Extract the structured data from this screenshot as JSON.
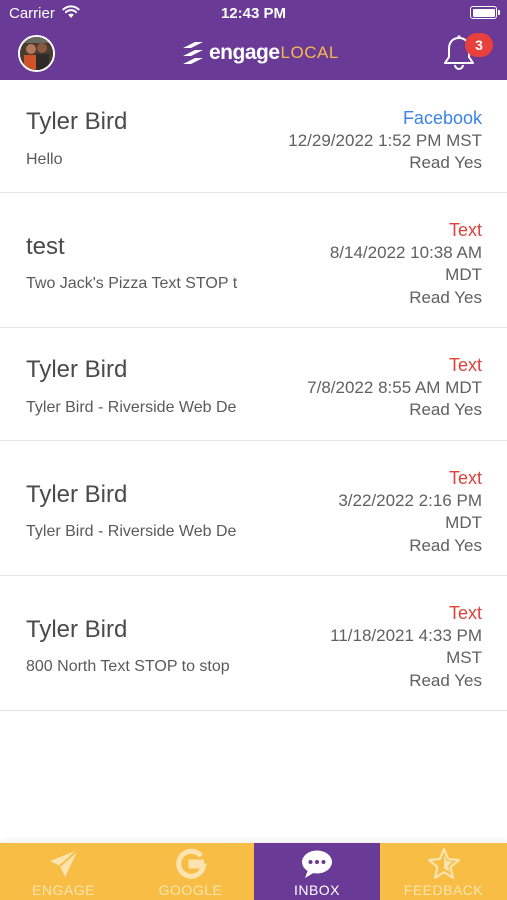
{
  "status_bar": {
    "carrier": "Carrier",
    "time": "12:43 PM",
    "wifi_icon": "wifi-icon",
    "battery_icon": "battery-icon"
  },
  "header": {
    "avatar": "profile-avatar",
    "logo_word_bold": "engage",
    "logo_word_light": "LOCAL",
    "notification_icon": "bell-icon",
    "notification_count": "3"
  },
  "messages": [
    {
      "name": "Tyler Bird",
      "preview": "Hello",
      "source": "Facebook",
      "datetime": "12/29/2022 1:52 PM MST",
      "read": "Read Yes"
    },
    {
      "name": "test",
      "preview": "Two Jack's Pizza  Text STOP t",
      "source": "Text",
      "datetime": "8/14/2022 10:38 AM MDT",
      "read": "Read Yes"
    },
    {
      "name": "Tyler Bird",
      "preview": "Tyler Bird - Riverside Web De",
      "source": "Text",
      "datetime": "7/8/2022 8:55 AM MDT",
      "read": "Read Yes"
    },
    {
      "name": "Tyler Bird",
      "preview": "Tyler Bird - Riverside Web De",
      "source": "Text",
      "datetime": "3/22/2022 2:16 PM MDT",
      "read": "Read Yes"
    },
    {
      "name": "Tyler Bird",
      "preview": "800 North Text STOP to stop",
      "source": "Text",
      "datetime": "11/18/2021 4:33 PM MST",
      "read": "Read Yes"
    }
  ],
  "tabs": [
    {
      "label": "ENGAGE",
      "icon": "paper-plane-icon",
      "active": false
    },
    {
      "label": "GOOGLE",
      "icon": "google-g-icon",
      "active": false
    },
    {
      "label": "INBOX",
      "icon": "chat-bubble-icon",
      "active": true
    },
    {
      "label": "FEEDBACK",
      "icon": "star-badge-icon",
      "active": false
    }
  ],
  "colors": {
    "brand_purple": "#6a3a97",
    "tab_yellow": "#f7bd45",
    "facebook_blue": "#3a83ea",
    "text_red": "#e0413b",
    "badge_red": "#e8403c"
  }
}
